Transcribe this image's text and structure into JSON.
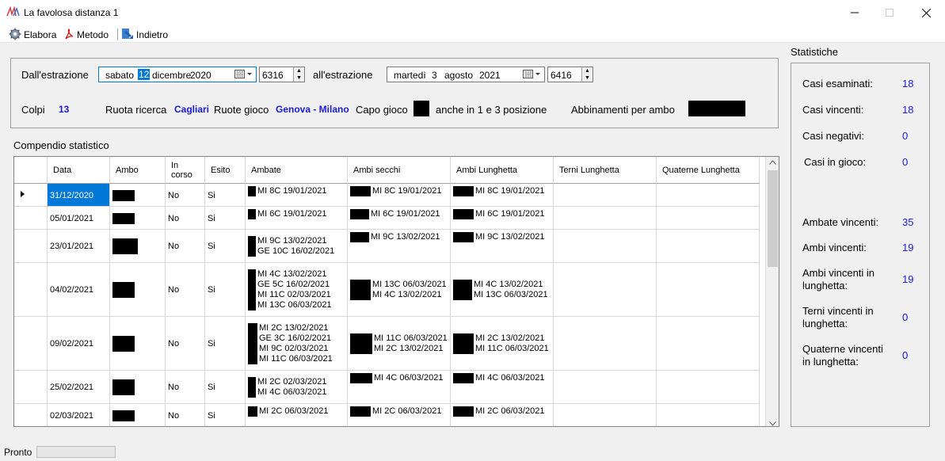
{
  "window": {
    "title": "La favolosa distanza 1"
  },
  "toolbar": {
    "elabora": "Elabora",
    "metodo": "Metodo",
    "indietro": "Indietro"
  },
  "params": {
    "from_label": "Dall'estrazione",
    "from_weekday": "sabato",
    "from_day": "12",
    "from_month": "dicembre",
    "from_year": "2020",
    "from_num": "6316",
    "to_label": "all'estrazione",
    "to_weekday": "martedì",
    "to_day": "3",
    "to_month": "agosto",
    "to_year": "2021",
    "to_num": "6416",
    "colpi_label": "Colpi",
    "colpi_value": "13",
    "ruota_ricerca_label": "Ruota ricerca",
    "ruota_ricerca_value": "Cagliari",
    "ruote_gioco_label": "Ruote gioco",
    "ruote_gioco_value": "Genova - Milano",
    "capo_gioco_label": "Capo gioco",
    "posizione_label": "anche in 1 e 3 posizione",
    "abbinamenti_label": "Abbinamenti per ambo"
  },
  "compendio": {
    "title": "Compendio statistico"
  },
  "grid": {
    "headers": [
      "Data",
      "Ambo",
      "In\ncorso",
      "Esito",
      "Ambate",
      "Ambi secchi",
      "Ambi Lunghetta",
      "Terni Lunghetta",
      "Quaterne Lunghetta"
    ],
    "rows": [
      {
        "date": "31/12/2020",
        "in_corso": "No",
        "esito": "Si",
        "ambate": "MI 8C 19/01/2021",
        "ambi_secchi": "MI 8C 19/01/2021",
        "ambi_lunghetta": "MI 8C 19/01/2021"
      },
      {
        "date": "05/01/2021",
        "in_corso": "No",
        "esito": "Si",
        "ambate": "MI 6C 19/01/2021",
        "ambi_secchi": "MI 6C 19/01/2021",
        "ambi_lunghetta": "MI 6C 19/01/2021"
      },
      {
        "date": "23/01/2021",
        "in_corso": "No",
        "esito": "Si",
        "ambate": "MI 9C 13/02/2021\nGE 10C 16/02/2021",
        "ambi_secchi": "MI 9C 13/02/2021",
        "ambi_lunghetta": "MI 9C 13/02/2021"
      },
      {
        "date": "04/02/2021",
        "in_corso": "No",
        "esito": "Si",
        "ambate": "MI 4C 13/02/2021\nGE 5C 16/02/2021\nMI 11C 02/03/2021\nMI 13C 06/03/2021",
        "ambi_secchi": "MI 13C 06/03/2021\nMI 4C 13/02/2021",
        "ambi_lunghetta": "MI 4C 13/02/2021\nMI 13C 06/03/2021"
      },
      {
        "date": "09/02/2021",
        "in_corso": "No",
        "esito": "Si",
        "ambate": "MI 2C 13/02/2021\nGE 3C 16/02/2021\nMI 9C 02/03/2021\nMI 11C 06/03/2021",
        "ambi_secchi": "MI 11C 06/03/2021\nMI 2C 13/02/2021",
        "ambi_lunghetta": "MI 2C 13/02/2021\nMI 11C 06/03/2021"
      },
      {
        "date": "25/02/2021",
        "in_corso": "No",
        "esito": "Si",
        "ambate": "MI 2C 02/03/2021\nMI 4C 06/03/2021",
        "ambi_secchi": "MI 4C 06/03/2021",
        "ambi_lunghetta": "MI 4C 06/03/2021"
      },
      {
        "date": "02/03/2021",
        "in_corso": "No",
        "esito": "Si",
        "ambate": "MI 2C 06/03/2021",
        "ambi_secchi": "MI 2C 06/03/2021",
        "ambi_lunghetta": "MI 2C 06/03/2021"
      }
    ]
  },
  "stats": {
    "title": "Statistiche",
    "items": [
      {
        "label": "Casi esaminati:",
        "value": "18"
      },
      {
        "label": "Casi vincenti:",
        "value": "18"
      },
      {
        "label": "Casi negativi:",
        "value": "0"
      },
      {
        "label": "Casi in gioco:",
        "value": "0"
      },
      {
        "label": "Ambate vincenti:",
        "value": "35"
      },
      {
        "label": "Ambi vincenti:",
        "value": "19"
      },
      {
        "label": "Ambi vincenti in\nlunghetta:",
        "value": "19"
      },
      {
        "label": "Terni vincenti in\nlunghetta:",
        "value": "0"
      },
      {
        "label": "Quaterne vincenti\nin lunghetta:",
        "value": "0"
      }
    ]
  },
  "status": {
    "text": "Pronto"
  },
  "colors": {
    "accent_blue": "#1a1ad8",
    "selected_row": "#0078d7"
  }
}
